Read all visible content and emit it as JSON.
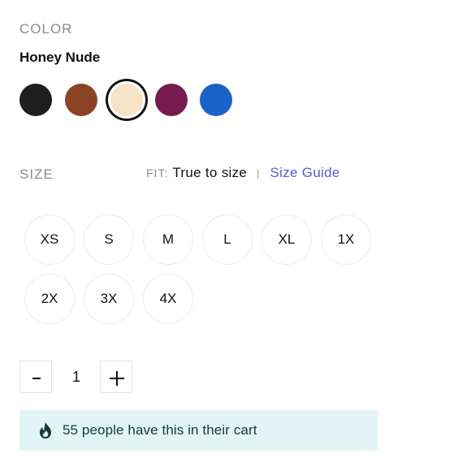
{
  "color_section": {
    "label": "COLOR",
    "selected_name": "Honey Nude",
    "swatches": [
      {
        "name": "black",
        "hex": "#1e1e1e",
        "selected": false
      },
      {
        "name": "brown",
        "hex": "#8a4424",
        "selected": false
      },
      {
        "name": "honey-nude",
        "hex": "#f7e4c6",
        "selected": true
      },
      {
        "name": "plum",
        "hex": "#761a4f",
        "selected": false
      },
      {
        "name": "blue",
        "hex": "#1d62c9",
        "selected": false
      }
    ],
    "selected_ring_color": "#141414"
  },
  "size_section": {
    "label": "SIZE",
    "fit_key": "FIT:",
    "fit_value": "True to size",
    "separator": "|",
    "size_guide_label": "Size Guide",
    "size_guide_color": "#5b5bd0",
    "sizes": [
      "XS",
      "S",
      "M",
      "L",
      "XL",
      "1X",
      "2X",
      "3X",
      "4X"
    ]
  },
  "quantity": {
    "value": "1",
    "decrement_icon": "minus-icon",
    "increment_icon": "plus-icon"
  },
  "cart_notice": {
    "icon": "flame-icon",
    "text": "55 people have this in their cart",
    "background": "#e3f4f6",
    "icon_color": "#123b40"
  }
}
